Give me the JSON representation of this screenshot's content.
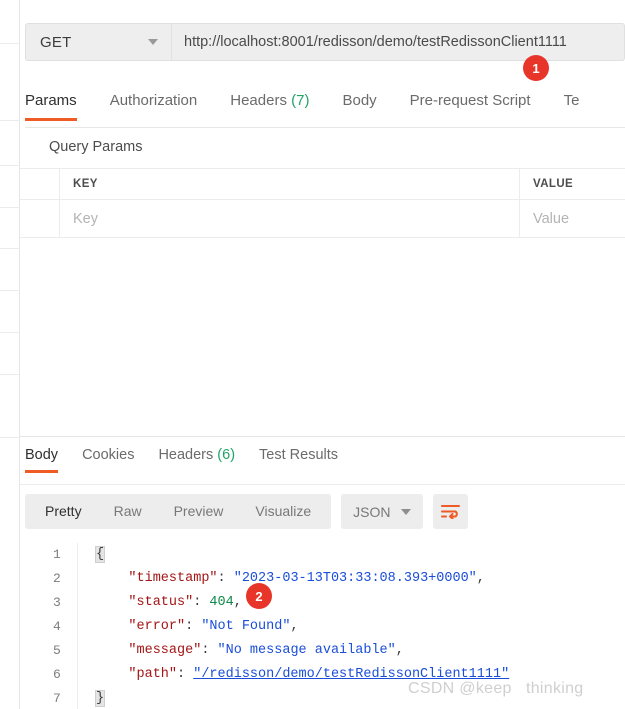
{
  "request": {
    "method": "GET",
    "method_caret_icon": "chevron-down-icon",
    "url": "http://localhost:8001/redisson/demo/testRedissonClient1111",
    "tabs": [
      {
        "label": "Params",
        "count": "",
        "active": true
      },
      {
        "label": "Authorization",
        "count": "",
        "active": false
      },
      {
        "label": "Headers",
        "count": "(7)",
        "active": false
      },
      {
        "label": "Body",
        "count": "",
        "active": false
      },
      {
        "label": "Pre-request Script",
        "count": "",
        "active": false
      },
      {
        "label": "Te",
        "count": "",
        "active": false
      }
    ],
    "query_params": {
      "section_title": "Query Params",
      "columns": [
        "KEY",
        "VALUE"
      ],
      "rows": [
        {
          "key_placeholder": "Key",
          "value_placeholder": "Value"
        }
      ]
    }
  },
  "response": {
    "tabs": [
      {
        "label": "Body",
        "count": "",
        "active": true
      },
      {
        "label": "Cookies",
        "count": "",
        "active": false
      },
      {
        "label": "Headers",
        "count": "(6)",
        "active": false
      },
      {
        "label": "Test Results",
        "count": "",
        "active": false
      }
    ],
    "view_modes": [
      {
        "label": "Pretty",
        "active": true
      },
      {
        "label": "Raw",
        "active": false
      },
      {
        "label": "Preview",
        "active": false
      },
      {
        "label": "Visualize",
        "active": false
      }
    ],
    "format": "JSON",
    "format_caret_icon": "chevron-down-icon",
    "wrap_icon": "word-wrap-icon",
    "body_lines": [
      {
        "n": "1",
        "indent": 0,
        "kind": "brace-open",
        "text": "{"
      },
      {
        "n": "2",
        "indent": 1,
        "kind": "pair-string",
        "key": "\"timestamp\"",
        "value": "\"2023-03-13T03:33:08.393+0000\"",
        "comma": ","
      },
      {
        "n": "3",
        "indent": 1,
        "kind": "pair-number",
        "key": "\"status\"",
        "value": "404",
        "comma": ","
      },
      {
        "n": "4",
        "indent": 1,
        "kind": "pair-string",
        "key": "\"error\"",
        "value": "\"Not Found\"",
        "comma": ","
      },
      {
        "n": "5",
        "indent": 1,
        "kind": "pair-string",
        "key": "\"message\"",
        "value": "\"No message available\"",
        "comma": ","
      },
      {
        "n": "6",
        "indent": 1,
        "kind": "pair-link",
        "key": "\"path\"",
        "value": "\"/redisson/demo/testRedissonClient1111\"",
        "comma": ""
      },
      {
        "n": "7",
        "indent": 0,
        "kind": "brace-close",
        "text": "}"
      }
    ],
    "body_json": {
      "timestamp": "2023-03-13T03:33:08.393+0000",
      "status": 404,
      "error": "Not Found",
      "message": "No message available",
      "path": "/redisson/demo/testRedissonClient1111"
    }
  },
  "annotations": [
    {
      "label": "1",
      "target": "url-field"
    },
    {
      "label": "2",
      "target": "status-value"
    }
  ],
  "watermark": "CSDN @keep   thinking",
  "colors": {
    "accent": "#ef5b25",
    "badge": "#e8352a",
    "count_green": "#21a366",
    "json_key": "#a31515",
    "json_string": "#1a4ed8",
    "json_number": "#0f8a4a",
    "toolbar_bg": "#ededed"
  }
}
